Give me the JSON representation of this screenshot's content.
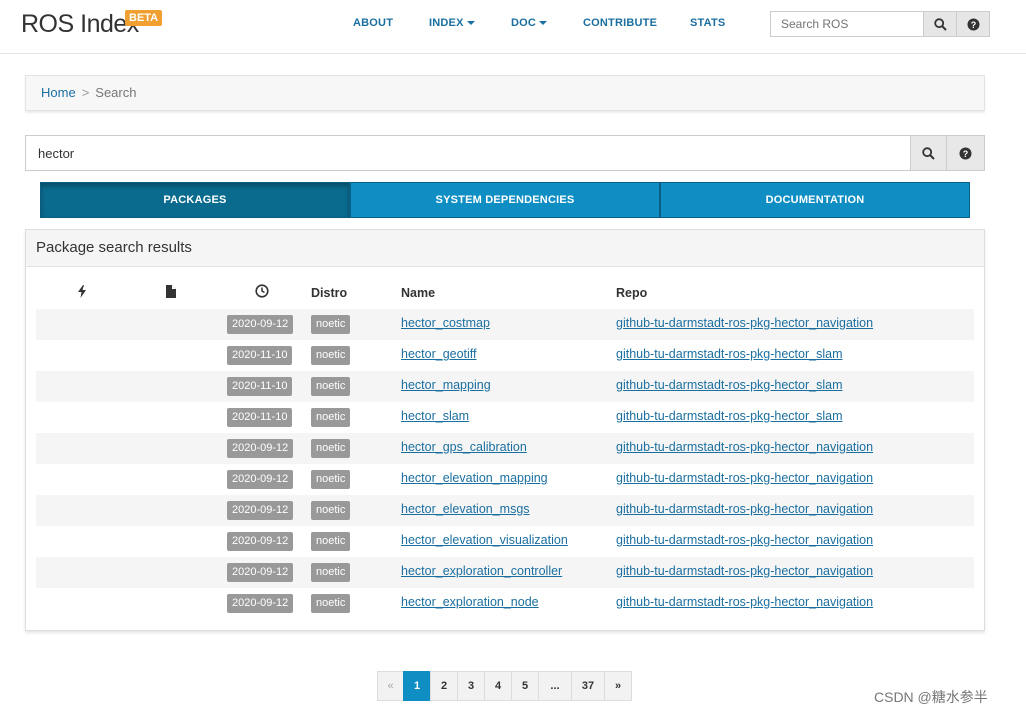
{
  "header": {
    "logo": "ROS Index",
    "beta": "BETA",
    "nav": {
      "about": "ABOUT",
      "index": "INDEX",
      "doc": "DOC",
      "contribute": "CONTRIBUTE",
      "stats": "STATS"
    },
    "search_placeholder": "Search ROS"
  },
  "breadcrumb": {
    "home": "Home",
    "separator": ">",
    "current": "Search"
  },
  "search": {
    "value": "hector"
  },
  "tabs": {
    "packages": "PACKAGES",
    "system_dependencies": "SYSTEM DEPENDENCIES",
    "documentation": "DOCUMENTATION"
  },
  "results": {
    "title": "Package search results",
    "columns": {
      "activity_icon": "bolt-icon",
      "file_icon": "file-icon",
      "time_icon": "clock-icon",
      "distro": "Distro",
      "name": "Name",
      "repo": "Repo"
    },
    "rows": [
      {
        "date": "2020-09-12",
        "distro": "noetic",
        "name": "hector_costmap",
        "repo": "github-tu-darmstadt-ros-pkg-hector_navigation"
      },
      {
        "date": "2020-11-10",
        "distro": "noetic",
        "name": "hector_geotiff",
        "repo": "github-tu-darmstadt-ros-pkg-hector_slam"
      },
      {
        "date": "2020-11-10",
        "distro": "noetic",
        "name": "hector_mapping",
        "repo": "github-tu-darmstadt-ros-pkg-hector_slam"
      },
      {
        "date": "2020-11-10",
        "distro": "noetic",
        "name": "hector_slam",
        "repo": "github-tu-darmstadt-ros-pkg-hector_slam"
      },
      {
        "date": "2020-09-12",
        "distro": "noetic",
        "name": "hector_gps_calibration",
        "repo": "github-tu-darmstadt-ros-pkg-hector_navigation"
      },
      {
        "date": "2020-09-12",
        "distro": "noetic",
        "name": "hector_elevation_mapping",
        "repo": "github-tu-darmstadt-ros-pkg-hector_navigation"
      },
      {
        "date": "2020-09-12",
        "distro": "noetic",
        "name": "hector_elevation_msgs",
        "repo": "github-tu-darmstadt-ros-pkg-hector_navigation"
      },
      {
        "date": "2020-09-12",
        "distro": "noetic",
        "name": "hector_elevation_visualization",
        "repo": "github-tu-darmstadt-ros-pkg-hector_navigation"
      },
      {
        "date": "2020-09-12",
        "distro": "noetic",
        "name": "hector_exploration_controller",
        "repo": "github-tu-darmstadt-ros-pkg-hector_navigation"
      },
      {
        "date": "2020-09-12",
        "distro": "noetic",
        "name": "hector_exploration_node",
        "repo": "github-tu-darmstadt-ros-pkg-hector_navigation"
      }
    ]
  },
  "pagination": {
    "prev": "«",
    "pages": [
      "1",
      "2",
      "3",
      "4",
      "5",
      "...",
      "37"
    ],
    "next": "»",
    "current": "1"
  },
  "watermark": "CSDN @糖水参半",
  "colors": {
    "accent": "#0f8ec4",
    "accent_dark": "#0a6b8f",
    "link": "#1b6fa0",
    "beta": "#f0a030",
    "badge": "#999999"
  }
}
